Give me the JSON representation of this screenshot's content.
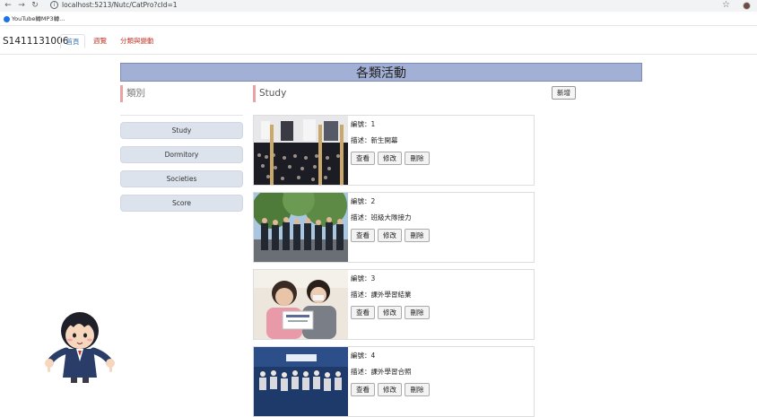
{
  "browser": {
    "url": "localhost:5213/Nutc/CatPro?cId=1",
    "bookmark_label": "YouTube轉MP3轉...",
    "colors": {
      "bookmark_icon": "#1a73e8"
    }
  },
  "navbar": {
    "brand": "S1411131006",
    "links": [
      "首頁",
      "週覽",
      "分類與變動"
    ]
  },
  "page": {
    "title": "各類活動",
    "sidebar_heading": "類別",
    "categories": [
      "Study",
      "Dormitory",
      "Societies",
      "Score"
    ],
    "content_heading": "Study",
    "add_label": "新增"
  },
  "cards": [
    {
      "no": "編號：1",
      "desc": "描述：新生開幕",
      "view": "查看",
      "edit": "修改",
      "del": "刪除"
    },
    {
      "no": "編號：2",
      "desc": "描述：班級大隊接力",
      "view": "查看",
      "edit": "修改",
      "del": "刪除"
    },
    {
      "no": "編號：3",
      "desc": "描述：課外學習結業",
      "view": "查看",
      "edit": "修改",
      "del": "刪除"
    },
    {
      "no": "編號：4",
      "desc": "描述：課外學習合照",
      "view": "查看",
      "edit": "修改",
      "del": "刪除"
    }
  ],
  "colors": {
    "title_bar": "#a3b0d6",
    "accent_left_border": "#e8a3a7",
    "category_button": "#dde3ed",
    "nav_link": "#c0392b",
    "nav_active": "#4a7bb7"
  }
}
